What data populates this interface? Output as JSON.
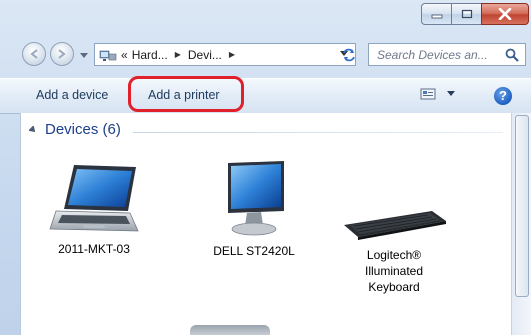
{
  "window": {
    "controls": {
      "minimize": "minimize-icon",
      "maximize": "maximize-icon",
      "close": "close-icon"
    }
  },
  "nav": {
    "breadcrumb": [
      "Hard...",
      "Devi..."
    ],
    "breadcrumb_prefix": "«",
    "search_placeholder": "Search Devices an..."
  },
  "toolbar": {
    "add_device": "Add a device",
    "add_printer": "Add a printer",
    "help": "?"
  },
  "content": {
    "group_label": "Devices (6)",
    "devices": [
      {
        "name": "2011-MKT-03",
        "icon": "laptop-icon"
      },
      {
        "name": "DELL ST2420L",
        "icon": "monitor-icon"
      },
      {
        "name": "Logitech®\nIlluminated\nKeyboard",
        "icon": "keyboard-icon"
      }
    ]
  },
  "colors": {
    "highlight": "#e0202a",
    "link_text": "#1e3f8a",
    "accent": "#1e5fc2"
  }
}
